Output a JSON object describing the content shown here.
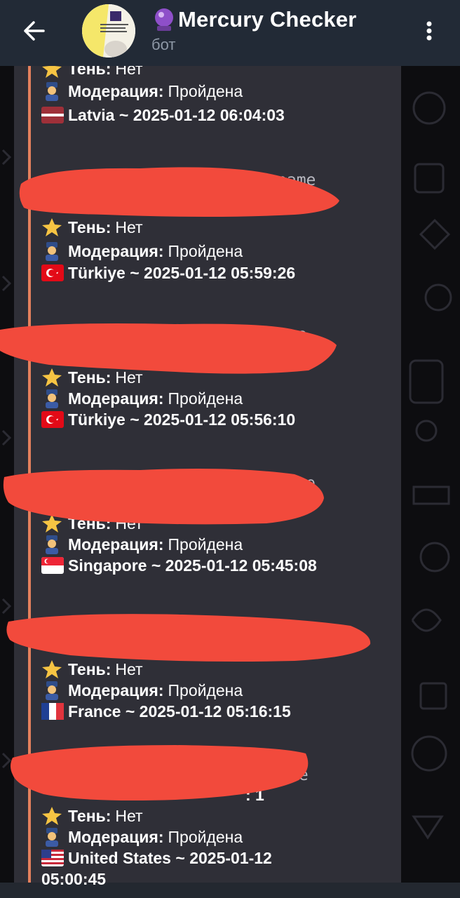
{
  "header": {
    "title": "Mercury Checker",
    "subtitle": "бот",
    "back_icon": "arrow-left-icon",
    "menu_icon": "more-vert-icon",
    "title_emoji": "crystal-ball-icon"
  },
  "colors": {
    "header_bg": "#222a36",
    "bubble_bg": "#2f2f37",
    "quote_bar": "#e4805d",
    "redaction": "#f24a3c"
  },
  "labels": {
    "shadow": "Тень:",
    "moderation": "Модерация:"
  },
  "entries": [
    {
      "shadow_value": "Нет",
      "moderation_value": "Пройдена",
      "country": "Latvia",
      "flag": "flag-latvia-icon",
      "timestamp": "~ 2025-01-12 06:04:03",
      "username_tail": ""
    },
    {
      "shadow_value": "Нет",
      "moderation_value": "Пройдена",
      "country": "Türkiye",
      "flag": "flag-turkiye-icon",
      "timestamp": "~ 2025-01-12 05:59:26",
      "username_tail": "name"
    },
    {
      "shadow_value": "Нет",
      "moderation_value": "Пройдена",
      "country": "Türkiye",
      "flag": "flag-turkiye-icon",
      "timestamp": "~ 2025-01-12 05:56:10",
      "username_tail": "me"
    },
    {
      "shadow_value": "Нет",
      "moderation_value": "Пройдена",
      "country": "Singapore",
      "flag": "flag-singapore-icon",
      "timestamp": "~ 2025-01-12 05:45:08",
      "username_tail": "e"
    },
    {
      "shadow_value": "Нет",
      "moderation_value": "Пройдена",
      "country": "France",
      "flag": "flag-france-icon",
      "timestamp": "~ 2025-01-12 05:16:15",
      "username_tail": ""
    },
    {
      "shadow_value": "Нет",
      "moderation_value": "Пройдена",
      "country": "United States",
      "flag": "flag-usa-icon",
      "timestamp": "~ 2025-01-12",
      "timestamp_wrap": "05:00:45",
      "username_tail": "me",
      "extra_tail": ": 1"
    }
  ]
}
